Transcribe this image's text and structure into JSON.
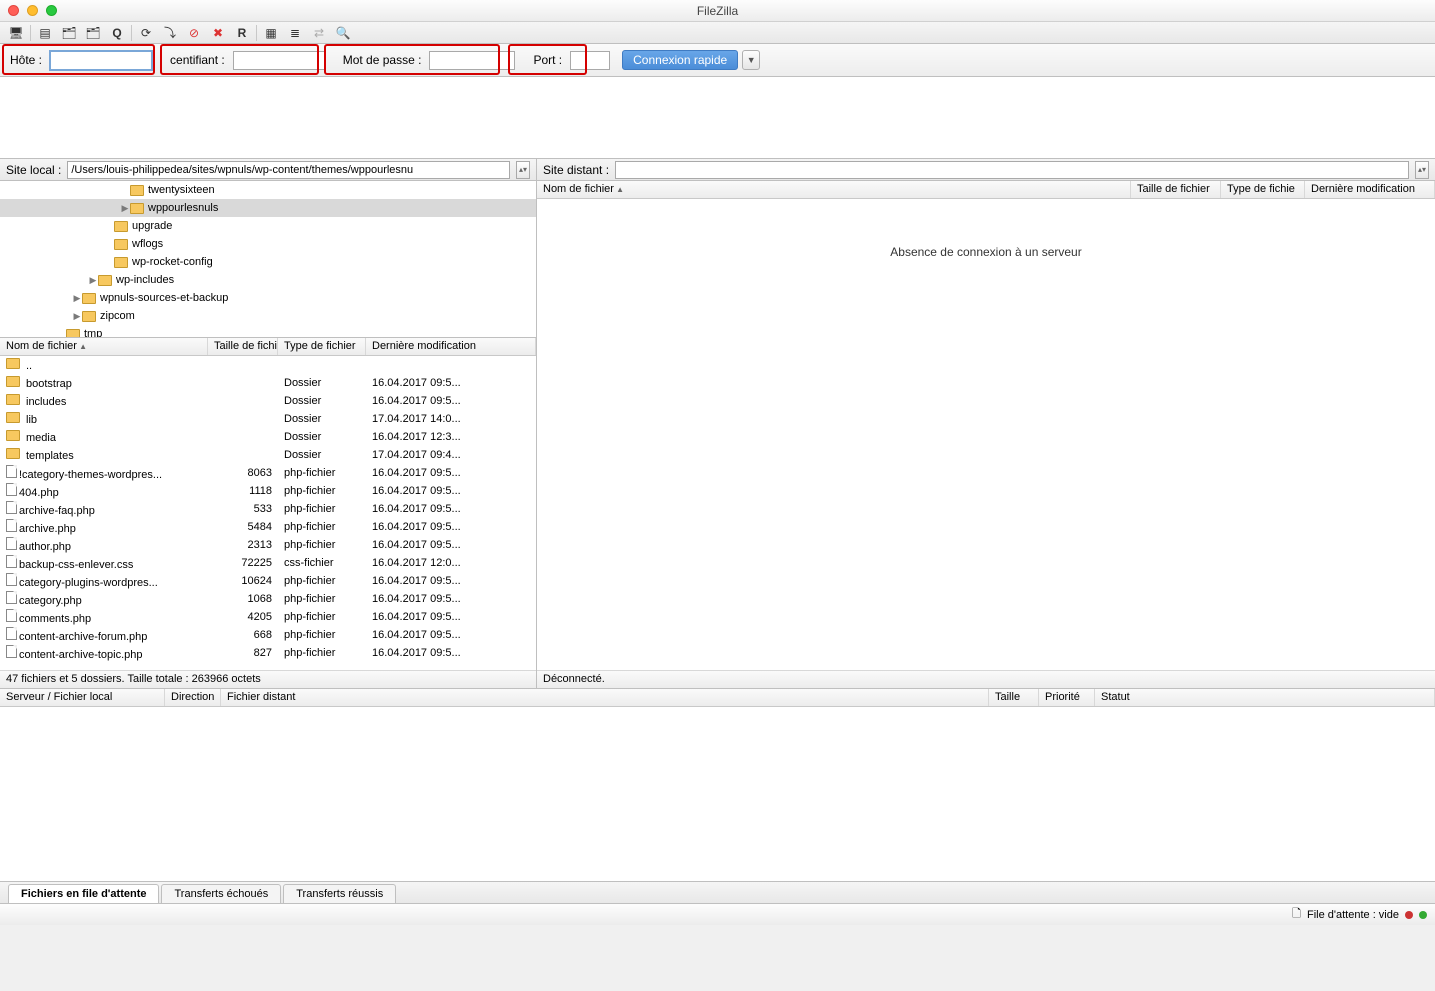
{
  "title": "FileZilla",
  "quickconnect": {
    "host_label": "Hôte :",
    "user_label": "Identifiant :",
    "pass_label": "Mot de passe :",
    "port_label": "Port :",
    "button": "Connexion rapide",
    "user_label_cropped": "centifiant :"
  },
  "local": {
    "label": "Site local :",
    "path": "/Users/louis-philippedea/sites/wpnuls/wp-content/themes/wppourlesnu",
    "tree": [
      {
        "indent": 120,
        "arrow": "",
        "name": "twentysixteen",
        "sel": false,
        "cut": true
      },
      {
        "indent": 120,
        "arrow": "▶",
        "name": "wppourlesnuls",
        "sel": true
      },
      {
        "indent": 104,
        "arrow": "",
        "name": "upgrade"
      },
      {
        "indent": 104,
        "arrow": "",
        "name": "wflogs"
      },
      {
        "indent": 104,
        "arrow": "",
        "name": "wp-rocket-config"
      },
      {
        "indent": 88,
        "arrow": "▶",
        "name": "wp-includes"
      },
      {
        "indent": 72,
        "arrow": "▶",
        "name": "wpnuls-sources-et-backup"
      },
      {
        "indent": 72,
        "arrow": "▶",
        "name": "zipcom"
      },
      {
        "indent": 56,
        "arrow": "",
        "name": "tmp"
      }
    ],
    "headers": {
      "name": "Nom de fichier",
      "size": "Taille de fichie",
      "type": "Type de fichier",
      "mod": "Dernière modification"
    },
    "files": [
      {
        "icon": "folder",
        "name": "..",
        "size": "",
        "type": "",
        "mod": ""
      },
      {
        "icon": "folder",
        "name": "bootstrap",
        "size": "",
        "type": "Dossier",
        "mod": "16.04.2017 09:5..."
      },
      {
        "icon": "folder",
        "name": "includes",
        "size": "",
        "type": "Dossier",
        "mod": "16.04.2017 09:5..."
      },
      {
        "icon": "folder",
        "name": "lib",
        "size": "",
        "type": "Dossier",
        "mod": "17.04.2017 14:0..."
      },
      {
        "icon": "folder",
        "name": "media",
        "size": "",
        "type": "Dossier",
        "mod": "16.04.2017 12:3..."
      },
      {
        "icon": "folder",
        "name": "templates",
        "size": "",
        "type": "Dossier",
        "mod": "17.04.2017 09:4..."
      },
      {
        "icon": "file",
        "name": "!category-themes-wordpres...",
        "size": "8063",
        "type": "php-fichier",
        "mod": "16.04.2017 09:5..."
      },
      {
        "icon": "file",
        "name": "404.php",
        "size": "1118",
        "type": "php-fichier",
        "mod": "16.04.2017 09:5..."
      },
      {
        "icon": "file",
        "name": "archive-faq.php",
        "size": "533",
        "type": "php-fichier",
        "mod": "16.04.2017 09:5..."
      },
      {
        "icon": "file",
        "name": "archive.php",
        "size": "5484",
        "type": "php-fichier",
        "mod": "16.04.2017 09:5..."
      },
      {
        "icon": "file",
        "name": "author.php",
        "size": "2313",
        "type": "php-fichier",
        "mod": "16.04.2017 09:5..."
      },
      {
        "icon": "file",
        "name": "backup-css-enlever.css",
        "size": "72225",
        "type": "css-fichier",
        "mod": "16.04.2017 12:0..."
      },
      {
        "icon": "file",
        "name": "category-plugins-wordpres...",
        "size": "10624",
        "type": "php-fichier",
        "mod": "16.04.2017 09:5..."
      },
      {
        "icon": "file",
        "name": "category.php",
        "size": "1068",
        "type": "php-fichier",
        "mod": "16.04.2017 09:5..."
      },
      {
        "icon": "file",
        "name": "comments.php",
        "size": "4205",
        "type": "php-fichier",
        "mod": "16.04.2017 09:5..."
      },
      {
        "icon": "file",
        "name": "content-archive-forum.php",
        "size": "668",
        "type": "php-fichier",
        "mod": "16.04.2017 09:5..."
      },
      {
        "icon": "file",
        "name": "content-archive-topic.php",
        "size": "827",
        "type": "php-fichier",
        "mod": "16.04.2017 09:5..."
      }
    ],
    "status": "47 fichiers et 5 dossiers. Taille totale : 263966 octets"
  },
  "remote": {
    "label": "Site distant :",
    "headers": {
      "name": "Nom de fichier",
      "size": "Taille de fichier",
      "type": "Type de fichie",
      "mod": "Dernière modification"
    },
    "placeholder": "Absence de connexion à un serveur",
    "status": "Déconnecté."
  },
  "queue": {
    "headers": {
      "local": "Serveur / Fichier local",
      "dir": "Direction",
      "remote": "Fichier distant",
      "size": "Taille",
      "prio": "Priorité",
      "status": "Statut"
    },
    "tabs": {
      "queued": "Fichiers en file d'attente",
      "failed": "Transferts échoués",
      "success": "Transferts réussis"
    }
  },
  "footer": {
    "queue": "File d'attente : vide"
  }
}
